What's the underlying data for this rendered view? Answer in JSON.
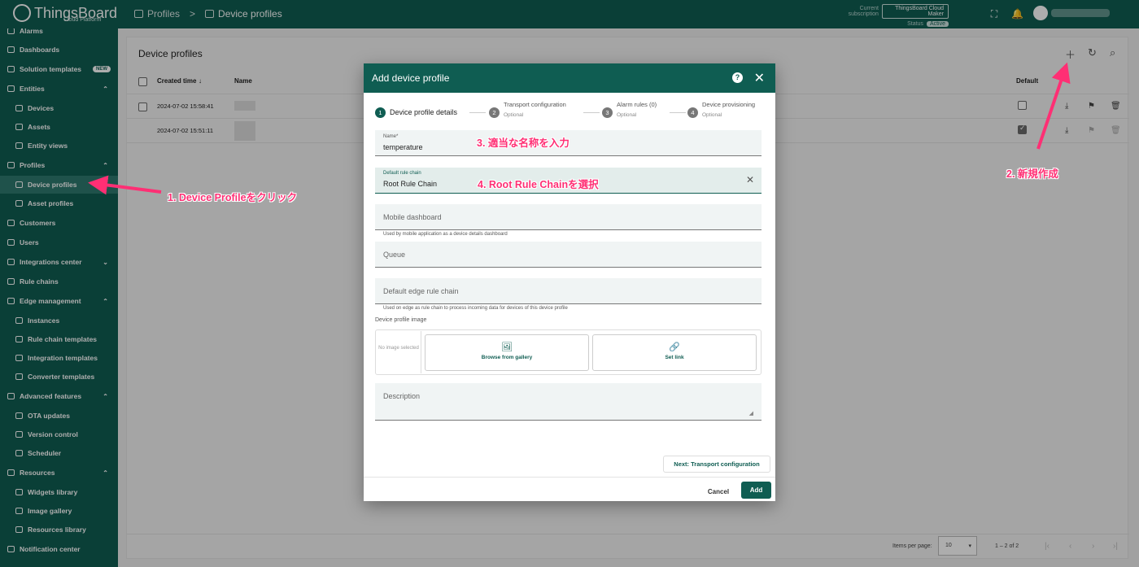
{
  "app": {
    "logo_text": "ThingsBoard",
    "logo_sub": "Cloud Platform"
  },
  "breadcrumb": {
    "parent": "Profiles",
    "separator": ">",
    "current": "Device profiles"
  },
  "subscription": {
    "label": "Current subscription",
    "plan": "ThingsBoard Cloud Maker",
    "status_label": "Status",
    "status_value": "Active"
  },
  "sidebar": {
    "items": [
      {
        "label": "Alarms"
      },
      {
        "label": "Dashboards"
      },
      {
        "label": "Solution templates",
        "badge": "NEW"
      },
      {
        "label": "Entities"
      },
      {
        "label": "Devices"
      },
      {
        "label": "Assets"
      },
      {
        "label": "Entity views"
      },
      {
        "label": "Profiles"
      },
      {
        "label": "Device profiles"
      },
      {
        "label": "Asset profiles"
      },
      {
        "label": "Customers"
      },
      {
        "label": "Users"
      },
      {
        "label": "Integrations center"
      },
      {
        "label": "Rule chains"
      },
      {
        "label": "Edge management"
      },
      {
        "label": "Instances"
      },
      {
        "label": "Rule chain templates"
      },
      {
        "label": "Integration templates"
      },
      {
        "label": "Converter templates"
      },
      {
        "label": "Advanced features"
      },
      {
        "label": "OTA updates"
      },
      {
        "label": "Version control"
      },
      {
        "label": "Scheduler"
      },
      {
        "label": "Resources"
      },
      {
        "label": "Widgets library"
      },
      {
        "label": "Image gallery"
      },
      {
        "label": "Resources library"
      },
      {
        "label": "Notification center"
      }
    ]
  },
  "page": {
    "title": "Device profiles",
    "columns": {
      "created_time": "Created time",
      "sort_arrow": "↓",
      "name": "Name",
      "default": "Default"
    },
    "rows": [
      {
        "created_time": "2024-07-02 15:58:41",
        "default": false
      },
      {
        "created_time": "2024-07-02 15:51:11",
        "default": true
      }
    ],
    "paginator": {
      "items_per_page_label": "Items per page:",
      "items_per_page": "10",
      "range": "1 – 2 of 2"
    }
  },
  "dialog": {
    "title": "Add device profile",
    "help": "?",
    "steps": [
      {
        "num": "1",
        "label": "Device profile details"
      },
      {
        "num": "2",
        "label": "Transport configuration",
        "sub": "Optional"
      },
      {
        "num": "3",
        "label": "Alarm rules (0)",
        "sub": "Optional"
      },
      {
        "num": "4",
        "label": "Device provisioning",
        "sub": "Optional"
      }
    ],
    "name_label": "Name*",
    "name_value": "temperature",
    "rule_chain_label": "Default rule chain",
    "rule_chain_value": "Root Rule Chain",
    "mobile_dashboard_ph": "Mobile dashboard",
    "mobile_dashboard_hint": "Used by mobile application as a device details dashboard",
    "queue_ph": "Queue",
    "edge_rule_chain_ph": "Default edge rule chain",
    "edge_rule_chain_hint": "Used on edge as rule chain to process incoming data for devices of this device profile",
    "image_label": "Device profile image",
    "no_image": "No image selected",
    "browse_label": "Browse from gallery",
    "set_link_label": "Set link",
    "description_ph": "Description",
    "next_button": "Next: Transport configuration",
    "cancel_button": "Cancel",
    "add_button": "Add"
  },
  "annotations": {
    "a1": "1. Device Profileをクリック",
    "a2": "2. 新規作成",
    "a3": "3. 適当な名称を入力",
    "a4": "4. Root Rule Chainを選択",
    "color": "#ff2f74"
  },
  "colors": {
    "brand": "#0f5d52"
  }
}
